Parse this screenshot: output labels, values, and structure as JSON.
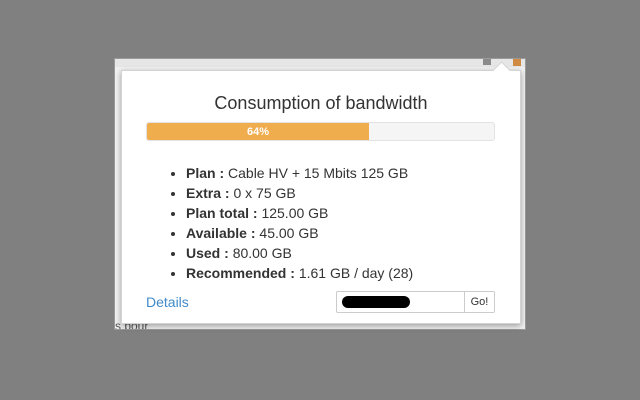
{
  "popup": {
    "title": "Consumption of bandwidth",
    "progress": {
      "label": "64%",
      "percent": 64,
      "color": "#f0ad4e",
      "track_color": "#f5f5f5"
    },
    "items": [
      {
        "label": "Plan :",
        "value": "Cable HV + 15 Mbits 125 GB"
      },
      {
        "label": "Extra :",
        "value": "0 x 75 GB"
      },
      {
        "label": "Plan total :",
        "value": "125.00 GB"
      },
      {
        "label": "Available :",
        "value": "45.00 GB"
      },
      {
        "label": "Used :",
        "value": "80.00 GB"
      },
      {
        "label": "Recommended :",
        "value": "1.61 GB / day (28)"
      }
    ],
    "details_link": "Details",
    "go_input_value": "",
    "go_button": "Go!",
    "link_color": "#428bca"
  },
  "background": {
    "edge_text": "s pour"
  }
}
